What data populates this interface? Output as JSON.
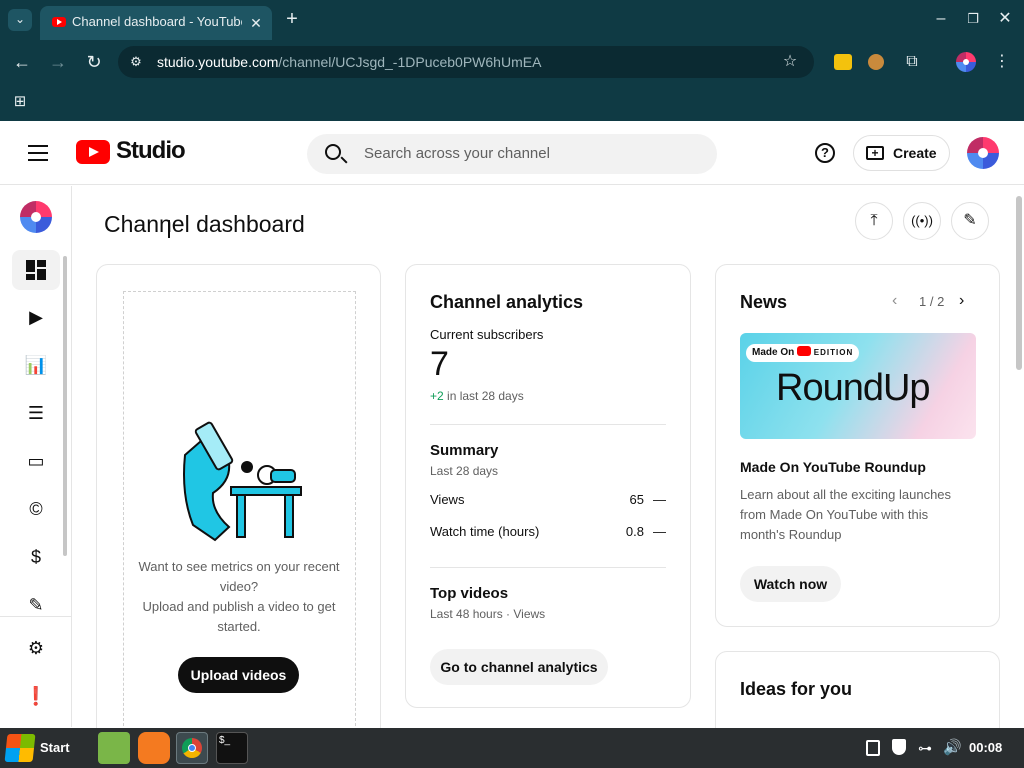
{
  "browser": {
    "tab_title": "Channel dashboard - YouTube",
    "url_domain": "studio.youtube.com",
    "url_path": "/channel/UCJsgd_-1DPuceb0PW6hUmEA"
  },
  "header": {
    "logo_text": "Studio",
    "search_placeholder": "Search across your channel",
    "create_label": "Create"
  },
  "page": {
    "title": "Channel dashboard"
  },
  "upload_card": {
    "prompt": "Want to see metrics on your recent video?",
    "prompt2": "Upload and publish a video to get started.",
    "button": "Upload videos"
  },
  "analytics": {
    "title": "Channel analytics",
    "subs_label": "Current subscribers",
    "subs_value": "7",
    "subs_delta": "+2",
    "subs_delta_suffix": " in last 28 days",
    "summary_title": "Summary",
    "summary_period": "Last 28 days",
    "rows": [
      {
        "label": "Views",
        "value": "65",
        "trend": "—"
      },
      {
        "label": "Watch time (hours)",
        "value": "0.8",
        "trend": "—"
      }
    ],
    "top_title": "Top videos",
    "top_period": "Last 48 hours · Views",
    "button": "Go to channel analytics"
  },
  "news": {
    "title": "News",
    "pager": "1 / 2",
    "thumb_badge_pre": "Made On",
    "thumb_badge_post": "EDITION",
    "thumb_title": "RoundUp",
    "headline": "Made On YouTube Roundup",
    "body": "Learn about all the exciting launches from Made On YouTube with this month's Roundup",
    "button": "Watch now"
  },
  "ideas": {
    "title": "Ideas for you"
  },
  "taskbar": {
    "start": "Start",
    "clock": "00:08"
  },
  "colors": {
    "chrome_bg": "#0f3a44",
    "youtube_red": "#ff0000",
    "positive": "#0f9d58",
    "taskbar": "#2a2e30"
  }
}
